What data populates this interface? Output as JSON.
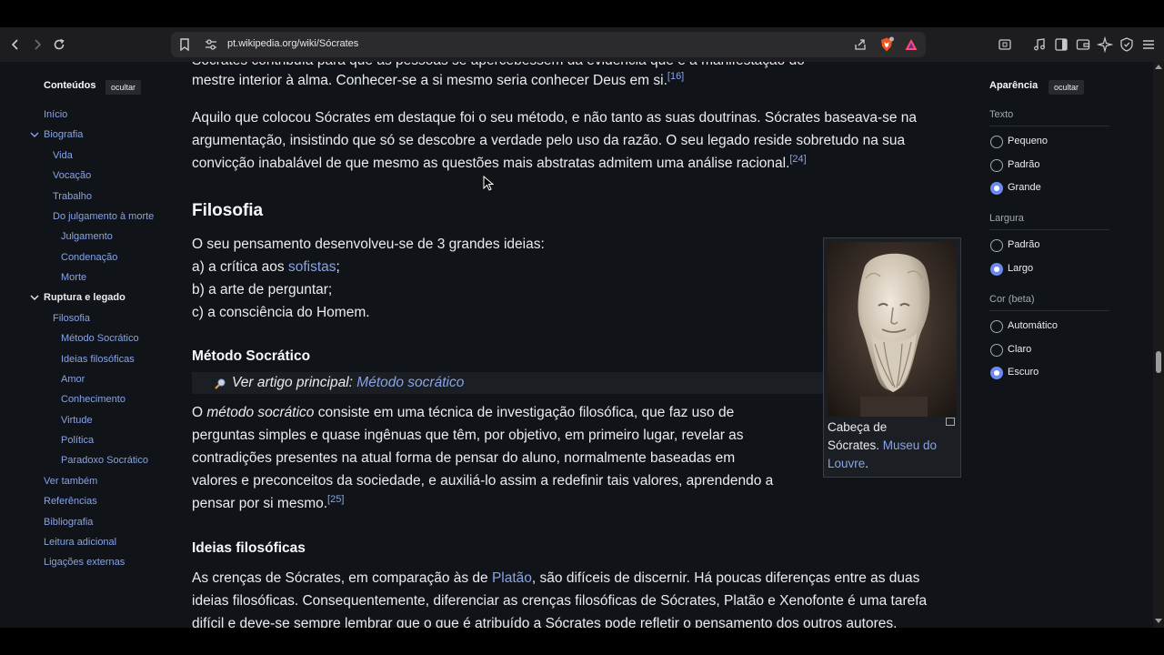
{
  "browser": {
    "url": "pt.wikipedia.org/wiki/Sócrates"
  },
  "toc": {
    "title": "Conteúdos",
    "hide_label": "ocultar",
    "items": [
      {
        "label": "Início"
      },
      {
        "label": "Biografia"
      },
      {
        "label": "Vida"
      },
      {
        "label": "Vocação"
      },
      {
        "label": "Trabalho"
      },
      {
        "label": "Do julgamento à morte"
      },
      {
        "label": "Julgamento"
      },
      {
        "label": "Condenação"
      },
      {
        "label": "Morte"
      },
      {
        "label": "Ruptura e legado"
      },
      {
        "label": "Filosofia"
      },
      {
        "label": "Método Socrático"
      },
      {
        "label": "Ideias filosóficas"
      },
      {
        "label": "Amor"
      },
      {
        "label": "Conhecimento"
      },
      {
        "label": "Virtude"
      },
      {
        "label": "Política"
      },
      {
        "label": "Paradoxo Socrático"
      },
      {
        "label": "Ver também"
      },
      {
        "label": "Referências"
      },
      {
        "label": "Bibliografia"
      },
      {
        "label": "Leitura adicional"
      },
      {
        "label": "Ligações externas"
      }
    ]
  },
  "article": {
    "cut_line": "Sócrates contribuía para que as pessoas se apercebessem da evidência que é a manifestação do",
    "p1_line2": "mestre interior à alma. Conhecer-se a si mesmo seria conhecer Deus em si.",
    "ref16": "[16]",
    "p2_line1": "Aquilo que colocou Sócrates em destaque foi o seu método, e não tanto as suas doutrinas. Sócrates baseava-se na",
    "p2_line2": "argumentação, insistindo que só se descobre a verdade pelo uso da razão. O seu legado reside sobretudo na sua",
    "p2_line3": "convicção inabalável de que mesmo as questões mais abstratas admitem uma análise racional.",
    "ref24": "[24]",
    "h_filosofia": "Filosofia",
    "f_line1": "O seu pensamento desenvolveu-se de 3 grandes ideias:",
    "f_line2_pre": "a) a crítica aos ",
    "f_line2_link": "sofistas",
    "f_line2_post": ";",
    "f_line3": "b) a arte de perguntar;",
    "f_line4": "c) a consciência do Homem.",
    "h_metodo": "Método Socrático",
    "hatnote_pre": "Ver artigo principal: ",
    "hatnote_link": "Método socrático",
    "m_line1_pre": "O ",
    "m_line1_em": "método socrático",
    "m_line1_post": " consiste em uma técnica de investigação filosófica, que faz uso de",
    "m_line2": "perguntas simples e quase ingênuas que têm, por objetivo, em primeiro lugar, revelar as",
    "m_line3": "contradições presentes na atual forma de pensar do aluno, normalmente baseadas em",
    "m_line4": "valores e preconceitos da sociedade, e auxiliá-lo assim a redefinir tais valores, aprendendo a",
    "m_line5": "pensar por si mesmo.",
    "ref25": "[25]",
    "h_ideias": "Ideias filosóficas",
    "i_line1_pre": "As crenças de Sócrates, em comparação às de ",
    "i_line1_link": "Platão",
    "i_line1_post": ", são difíceis de discernir. Há poucas diferenças entre as duas",
    "i_line2": "ideias filosóficas. Consequentemente, diferenciar as crenças filosóficas de Sócrates, Platão e Xenofonte é uma tarefa",
    "i_line3": "difícil e deve-se sempre lembrar que o que é atribuído a Sócrates pode refletir o pensamento dos outros autores.",
    "figure": {
      "cap_line1": "Cabeça de",
      "cap_line2": "Sócrates. ",
      "cap_link1": "Museu do",
      "cap_link2": "Louvre",
      "cap_end": "."
    }
  },
  "appearance": {
    "title": "Aparência",
    "hide_label": "ocultar",
    "text_title": "Texto",
    "text_options": [
      "Pequeno",
      "Padrão",
      "Grande"
    ],
    "text_selected": "Grande",
    "width_title": "Largura",
    "width_options": [
      "Padrão",
      "Largo"
    ],
    "width_selected": "Largo",
    "color_title": "Cor (beta)",
    "color_options": [
      "Automático",
      "Claro",
      "Escuro"
    ],
    "color_selected": "Escuro"
  },
  "icons": [
    "back-icon",
    "forward-icon",
    "reload-icon",
    "bookmark-icon",
    "site-settings-icon",
    "share-icon",
    "brave-shields-icon",
    "brave-rewards-icon",
    "tab-search-icon",
    "media-icon",
    "sidebar-icon",
    "wallet-icon",
    "leo-ai-icon",
    "vpn-icon",
    "menu-icon"
  ]
}
